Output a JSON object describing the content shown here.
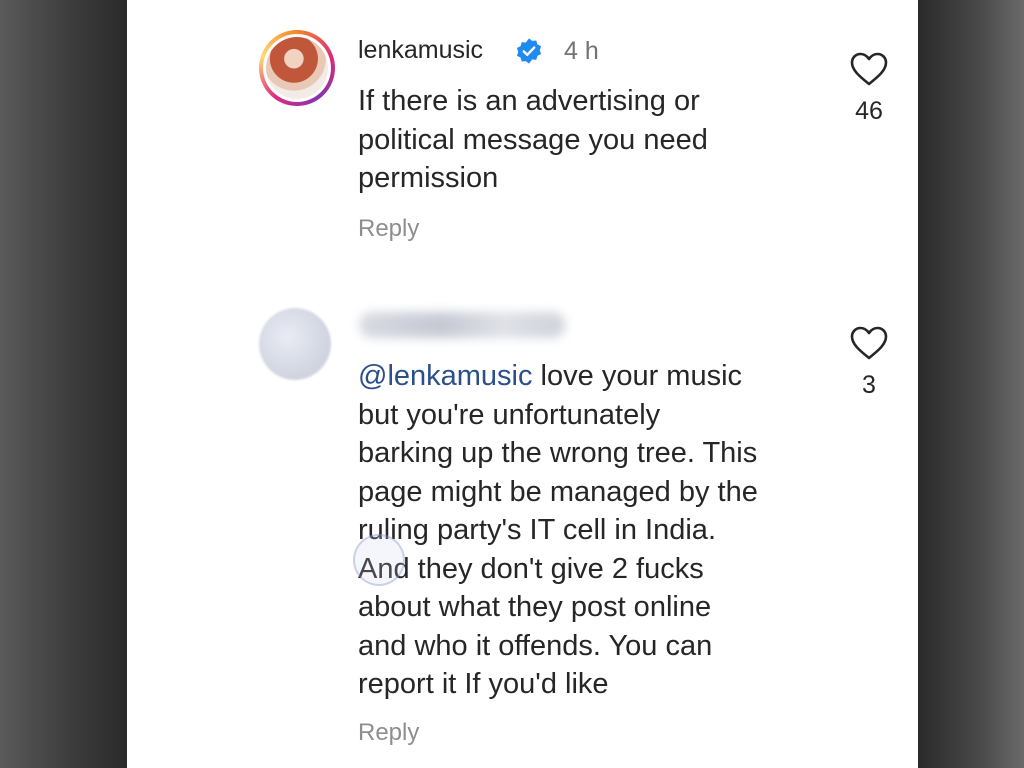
{
  "comments": [
    {
      "username": "lenkamusic",
      "verified": true,
      "time": "4 h",
      "text_lines": [
        "If there is an advertising or",
        "political message you need",
        "permission"
      ],
      "reply_label": "Reply",
      "likes": "46",
      "avatar": "profile-photo-story-ring"
    },
    {
      "username_blurred": true,
      "mention": "@lenkamusic",
      "text_first_line_rest": " love your music",
      "text_lines": [
        "but you're unfortunately",
        "barking up the wrong tree. This",
        "page might be managed by the",
        "ruling party's IT cell in India.",
        "And they don't give 2 fucks",
        "about what they post online",
        "and who it offends. You can",
        "report it If you'd like"
      ],
      "reply_label": "Reply",
      "likes": "3",
      "avatar": "blurred-avatar"
    }
  ],
  "icons": {
    "like": "heart-outline-icon",
    "verified": "verified-badge-icon"
  },
  "colors": {
    "text": "#262626",
    "muted": "#737373",
    "reply": "#8e8e8e",
    "mention": "#2b4f8a",
    "verified": "#1f8bf0"
  }
}
